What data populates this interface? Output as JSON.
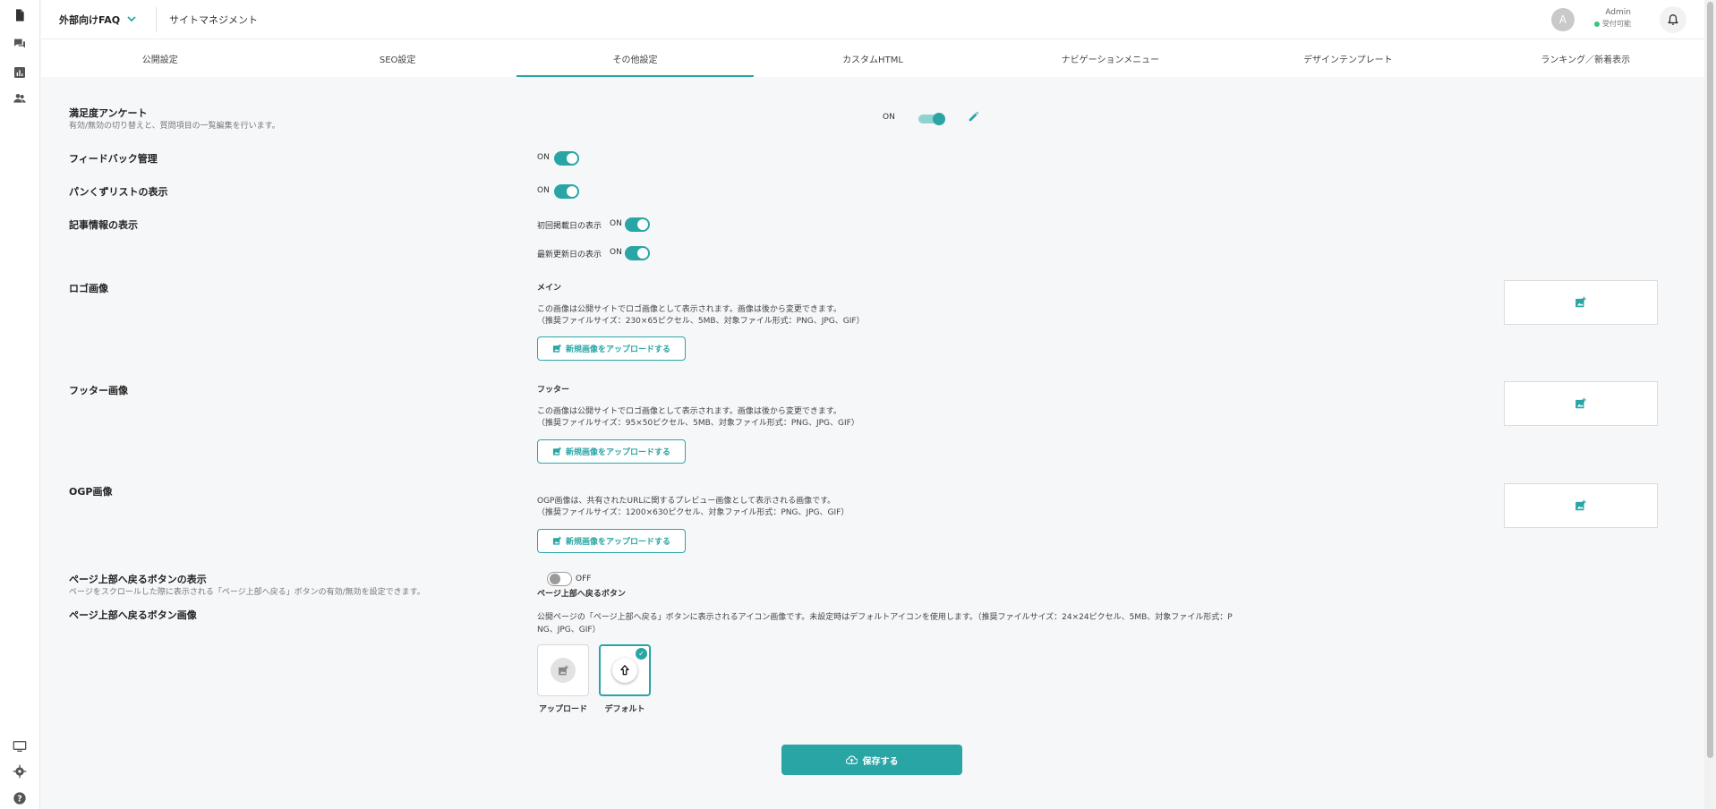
{
  "header": {
    "site_selector": "外部向けFAQ",
    "page_title": "サイトマネジメント",
    "avatar_initial": "A",
    "user_name": "Admin",
    "user_status": "受付可能"
  },
  "tabs": [
    {
      "label": "公開設定"
    },
    {
      "label": "SEO設定"
    },
    {
      "label": "その他設定"
    },
    {
      "label": "カスタムHTML"
    },
    {
      "label": "ナビゲーションメニュー"
    },
    {
      "label": "デザインテンプレート"
    },
    {
      "label": "ランキング／新着表示"
    }
  ],
  "survey": {
    "label": "満足度アンケート",
    "description": "有効/無効の切り替えと、質問項目の一覧編集を行います。",
    "status": "ON"
  },
  "feedback": {
    "label": "フィードバック管理",
    "status": "ON"
  },
  "breadcrumb": {
    "label": "パンくずリストの表示",
    "status": "ON"
  },
  "article_info": {
    "label": "記事情報の表示",
    "first_published_label": "初回掲載日の表示",
    "first_published_status": "ON",
    "last_updated_label": "最新更新日の表示",
    "last_updated_status": "ON"
  },
  "logo": {
    "label": "ロゴ画像",
    "sub_label": "メイン",
    "desc1": "この画像は公開サイトでロゴ画像として表示されます。画像は後から変更できます。",
    "desc2": "（推奨ファイルサイズ：230×65ピクセル、5MB、対象ファイル形式：PNG、JPG、GIF）",
    "button": "新規画像をアップロードする"
  },
  "footer_image": {
    "label": "フッター画像",
    "sub_label": "フッター",
    "desc1": "この画像は公開サイトでロゴ画像として表示されます。画像は後から変更できます。",
    "desc2": "（推奨ファイルサイズ：95×50ピクセル、5MB、対象ファイル形式：PNG、JPG、GIF）",
    "button": "新規画像をアップロードする"
  },
  "ogp": {
    "label": "OGP画像",
    "desc1": "OGP画像は、共有されたURLに関するプレビュー画像として表示される画像です。",
    "desc2": "（推奨ファイルサイズ：1200×630ピクセル、対象ファイル形式：PNG、JPG、GIF）",
    "button": "新規画像をアップロードする"
  },
  "back_to_top": {
    "label": "ページ上部へ戻るボタンの表示",
    "description": "ページをスクロールした際に表示される「ページ上部へ戻る」ボタンの有効/無効を設定できます。",
    "status": "OFF",
    "sub_label": "ページ上部へ戻るボタン"
  },
  "back_to_top_image": {
    "label": "ページ上部へ戻るボタン画像",
    "desc1": "公開ページの「ページ上部へ戻る」ボタンに表示されるアイコン画像です。未設定時はデフォルトアイコンを使用します。（推奨ファイルサイズ：24×24ピクセル、5MB、対象ファイル形式：P",
    "desc2": "NG、JPG、GIF）",
    "option_upload": "アップロード",
    "option_default": "デフォルト"
  },
  "save_button": "保存する",
  "colors": {
    "accent": "#2aa5a5",
    "background": "#f6f7f9"
  },
  "icons": [
    "document-icon",
    "chat-icon",
    "chart-icon",
    "users-icon",
    "monitor-icon",
    "gear-icon",
    "help-icon",
    "bell-icon",
    "pencil-icon",
    "image-add-icon",
    "cloud-upload-icon",
    "arrow-up-icon",
    "check-icon",
    "chevron-down-icon"
  ]
}
